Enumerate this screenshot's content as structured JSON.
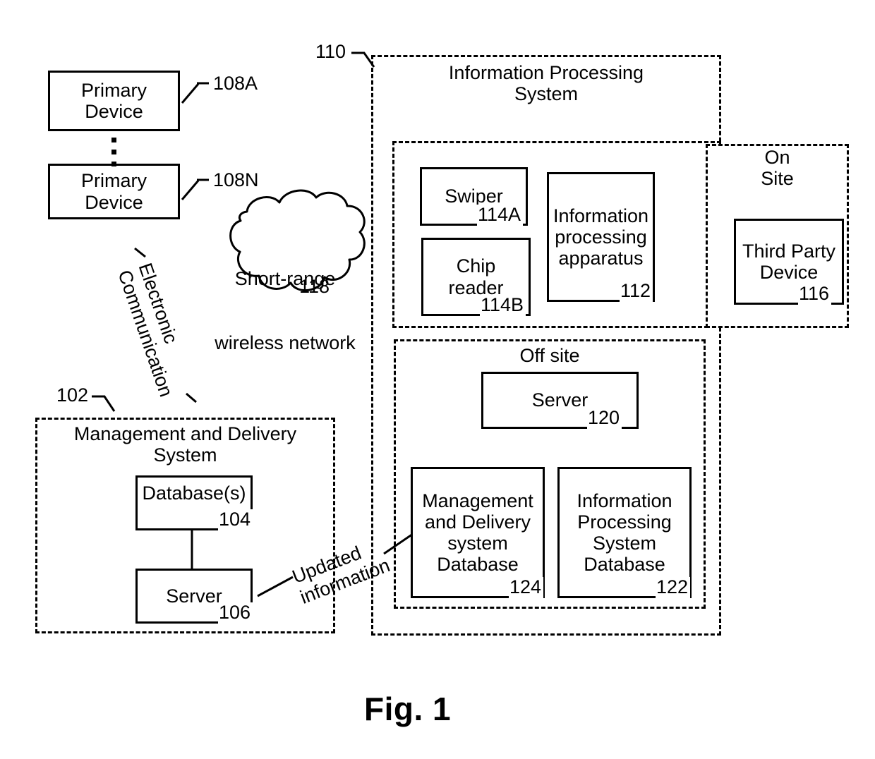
{
  "figure": {
    "caption": "Fig. 1"
  },
  "management_delivery_system": {
    "ref": "102",
    "title_line1": "Management and Delivery",
    "title_line2": "System",
    "database": {
      "label": "Database(s)",
      "ref": "104"
    },
    "server": {
      "label": "Server",
      "ref": "106"
    }
  },
  "primary_devices": [
    {
      "label_line1": "Primary",
      "label_line2": "Device",
      "ref": "108A"
    },
    {
      "label_line1": "Primary",
      "label_line2": "Device",
      "ref": "108N"
    }
  ],
  "ellipsis_between_devices": "vertical-ellipsis",
  "network_cloud": {
    "label_line1": "Short-range",
    "label_line2": "wireless network",
    "ref": "118"
  },
  "connections": {
    "electronic_communication": "Electronic\nCommunication",
    "updated_information": "Updated\ninformation"
  },
  "information_processing_system": {
    "ref": "110",
    "title_line1": "Information Processing",
    "title_line2": "System",
    "on_site": {
      "label_line1": "On",
      "label_line2": "Site",
      "devices": [
        {
          "label_line1": "Swiper",
          "label_line2": "",
          "ref": "114A"
        },
        {
          "label_line1": "Chip",
          "label_line2": "reader",
          "ref": "114B"
        },
        {
          "label_line1": "Information",
          "label_line2": "processing",
          "label_line3": "apparatus",
          "ref": "112"
        }
      ],
      "third_party_device": {
        "label_line1": "Third Party",
        "label_line2": "Device",
        "ref": "116"
      }
    },
    "off_site": {
      "label": "Off site",
      "server": {
        "label": "Server",
        "ref": "120"
      },
      "mds_database": {
        "label_line1": "Management",
        "label_line2": "and Delivery",
        "label_line3": "system",
        "label_line4": "Database",
        "ref": "124"
      },
      "ips_database": {
        "label_line1": "Information",
        "label_line2": "Processing",
        "label_line3": "System",
        "label_line4": "Database",
        "ref": "122"
      }
    }
  },
  "colors": {
    "stroke": "#000000",
    "background": "#ffffff"
  }
}
